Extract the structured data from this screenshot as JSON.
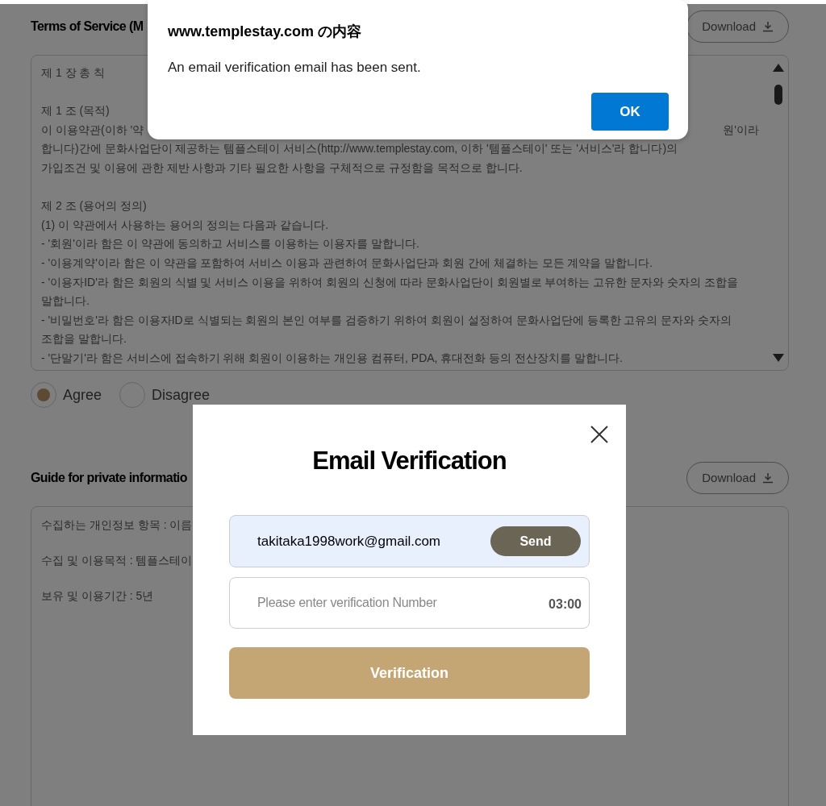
{
  "terms_section": {
    "title": "Terms of Service (M",
    "download_label": "Download",
    "paragraphs": [
      [
        {
          "kind": "text",
          "text": "제 1 장 총 칙"
        }
      ],
      [
        {
          "kind": "text",
          "text": "제 1 조 (목적)"
        },
        {
          "kind": "split",
          "parts": [
            "이 이용약관(이하 '약",
            "원'이라"
          ]
        },
        {
          "kind": "text",
          "text": "합니다)간에 문화사업단이 제공하는 템플스테이 서비스(http://www.templestay.com, 이하 '템플스테이' 또는 '서비스'라 합니다)의"
        },
        {
          "kind": "text",
          "text": "가입조건 및 이용에 관한 제반 사항과 기타 필요한 사항을 구체적으로 규정함을 목적으로 합니다."
        }
      ],
      [
        {
          "kind": "text",
          "text": "제 2 조 (용어의 정의)"
        },
        {
          "kind": "text",
          "text": "(1) 이 약관에서 사용하는 용어의 정의는 다음과 같습니다."
        },
        {
          "kind": "text",
          "text": "- '회원'이라 함은 이 약관에 동의하고 서비스를 이용하는 이용자를 말합니다."
        },
        {
          "kind": "text",
          "text": "- '이용계약'이라 함은 이 약관을 포함하여 서비스 이용과 관련하여 문화사업단과 회원 간에 체결하는 모든 계약을 말합니다."
        },
        {
          "kind": "text",
          "text": "- '이용자ID'라 함은 회원의 식별 및 서비스 이용을 위하여 회원의 신청에 따라 문화사업단이 회원별로 부여하는 고유한 문자와 숫자의 조합을"
        },
        {
          "kind": "text",
          "text": "말합니다."
        },
        {
          "kind": "text",
          "text": "- '비밀번호'라 함은 이용자ID로 식별되는 회원의 본인 여부를 검증하기 위하여 회원이 설정하여 문화사업단에 등록한 고유의 문자와 숫자의"
        },
        {
          "kind": "text",
          "text": "조합을 말합니다."
        },
        {
          "kind": "text",
          "text": "- '단말기'라 함은 서비스에 접속하기 위해 회원이 이용하는 개인용 컴퓨터, PDA, 휴대전화 등의 전산장치를 말합니다."
        }
      ]
    ],
    "options": [
      {
        "label": "Agree",
        "selected": true
      },
      {
        "label": "Disagree",
        "selected": false
      }
    ]
  },
  "privacy_section": {
    "title": "Guide for private informatio",
    "download_label": "Download",
    "lines": [
      "수집하는 개인정보 항목 : 이름",
      "수집 및 이용목적 : 템플스테이",
      "보유 및 이용기간 : 5년"
    ]
  },
  "alert": {
    "title": "www.templestay.com の内容",
    "message": "An email verification email has been sent.",
    "ok_label": "OK"
  },
  "modal": {
    "title": "Email Verification",
    "email_value": "takitaka1998work@gmail.com",
    "send_label": "Send",
    "code_placeholder": "Please enter verification Number",
    "timer": "03:00",
    "verify_label": "Verification"
  }
}
